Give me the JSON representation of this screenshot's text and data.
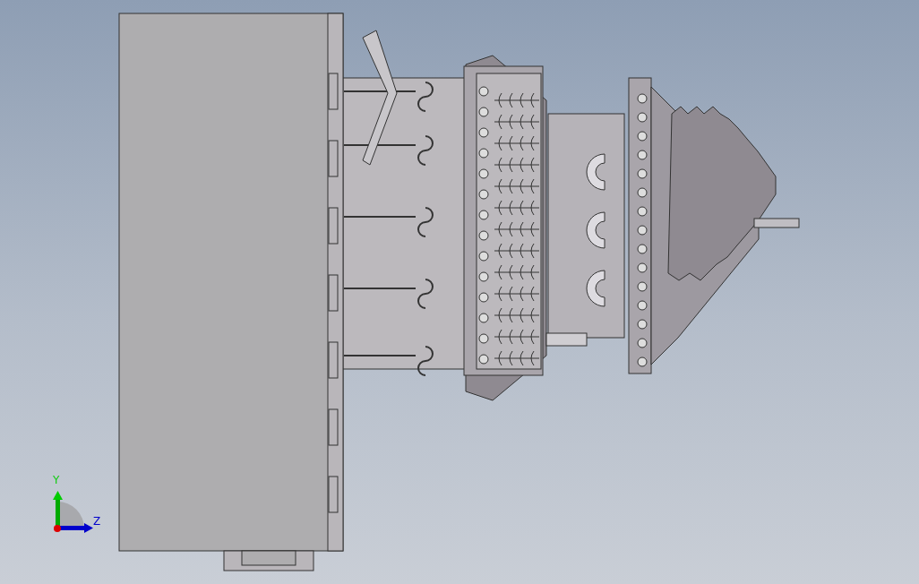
{
  "viewport": {
    "triad": {
      "axes": [
        {
          "label": "Y",
          "kind": "vertical"
        },
        {
          "label": "Z",
          "kind": "horizontal"
        }
      ]
    }
  }
}
